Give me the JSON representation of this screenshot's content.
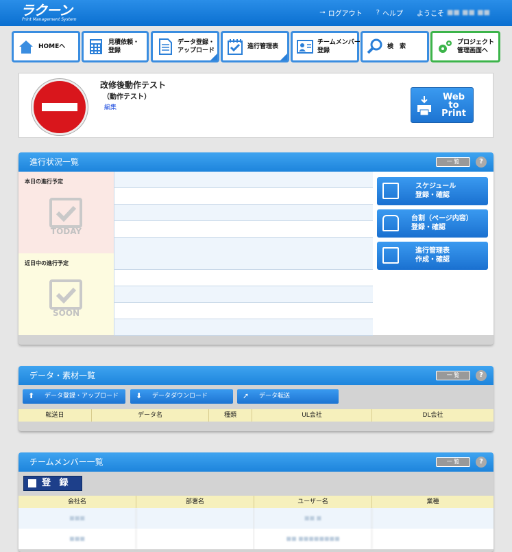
{
  "header": {
    "logo": "ラクーン",
    "logo_sub": "Print Management System",
    "logout": "ログアウト",
    "help": "ヘルプ",
    "welcome": "ようこそ",
    "user_name": "■■ ■■ ■■"
  },
  "nav": [
    {
      "label": "HOMEへ",
      "icon": "home-icon"
    },
    {
      "label": "見積依頼・\n登録",
      "icon": "calculator-icon"
    },
    {
      "label": "データ登録・\nアップロード",
      "icon": "document-icon"
    },
    {
      "label": "進行管理表",
      "icon": "checklist-icon"
    },
    {
      "label": "チームメンバー\n登録",
      "icon": "member-icon"
    },
    {
      "label": "検　索",
      "icon": "search-icon"
    },
    {
      "label": "プロジェクト\n管理画面へ",
      "icon": "gear-icon"
    }
  ],
  "project": {
    "title": "改修後動作テスト",
    "subtitle": "（動作テスト）",
    "edit": "編集",
    "web_to_print": "Web\nto\nPrint"
  },
  "progress": {
    "title": "進行状況一覧",
    "list_button": "一 覧",
    "help": "?",
    "today_label": "本日の進行予定",
    "today_caption": "TODAY",
    "soon_label": "近日中の進行予定",
    "soon_caption": "SOON",
    "buttons": [
      {
        "label": "スケジュール\n登録・確認"
      },
      {
        "label": "台割（ページ内容）\n登録・確認"
      },
      {
        "label": "進行管理表\n作成・確認"
      }
    ]
  },
  "data_panel": {
    "title": "データ・素材一覧",
    "list_button": "一 覧",
    "help": "?",
    "actions": [
      "データ登録・アップロード",
      "データダウンロード",
      "データ転送"
    ],
    "columns": [
      "転送日",
      "データ名",
      "種類",
      "UL会社",
      "DL会社"
    ]
  },
  "team_panel": {
    "title": "チームメンバー一覧",
    "list_button": "一 覧",
    "help": "?",
    "register": "登 録",
    "columns": [
      "会社名",
      "部署名",
      "ユーザー名",
      "業種"
    ],
    "rows": [
      [
        "■■■",
        "",
        "■■ ■",
        ""
      ],
      [
        "■■■",
        "",
        "■■ ■■■■■■■■",
        ""
      ]
    ]
  }
}
